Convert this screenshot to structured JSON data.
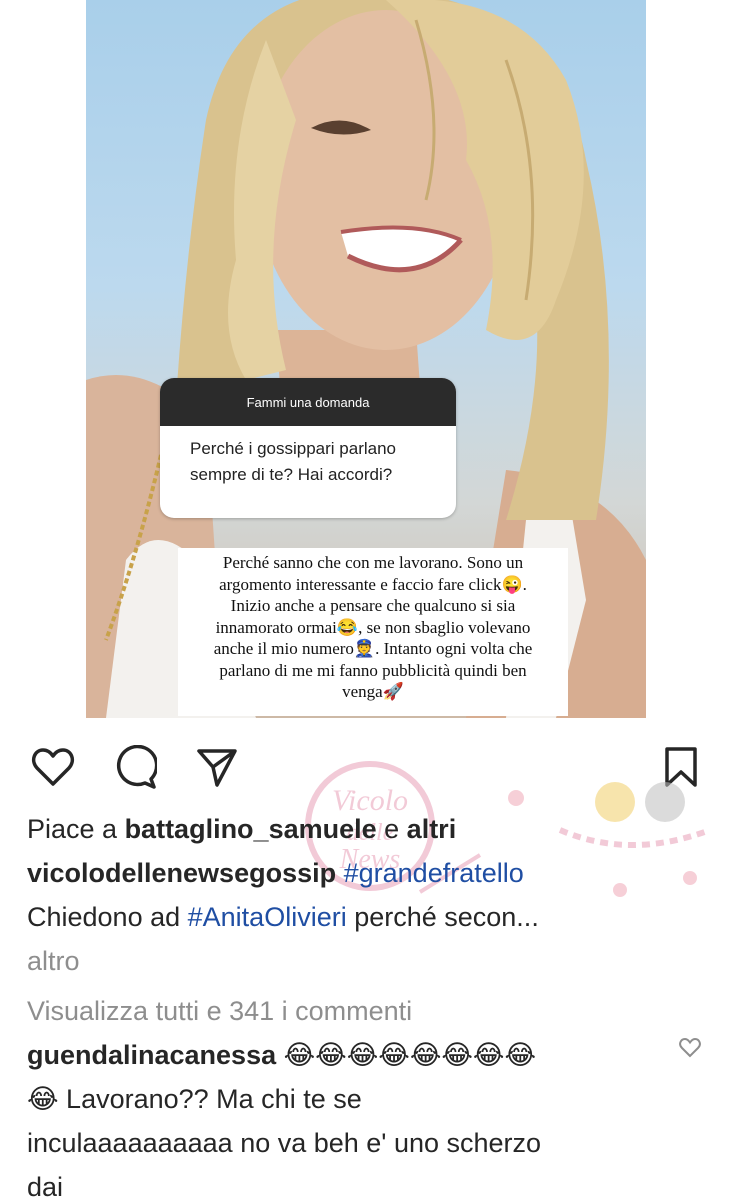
{
  "story": {
    "question_header": "Fammi una domanda",
    "question_lines": [
      "Perché i gossippari parlano",
      "sempre di te? Hai accordi?"
    ],
    "answer_lines": [
      "Perché sanno che con me lavorano. Sono un",
      "argomento interessante e faccio fare click😜.",
      "Inizio anche a pensare che qualcuno si sia",
      "innamorato ormai😂, se non sbaglio volevano",
      "anche il mio numero👮. Intanto ogni volta che",
      "parlano di me mi fanno pubblicità quindi ben",
      "venga🚀"
    ]
  },
  "actions": {
    "like_icon": "heart-icon",
    "comment_icon": "comment-icon",
    "share_icon": "send-icon",
    "save_icon": "bookmark-icon"
  },
  "likes": {
    "prefix": "Piace a ",
    "user": "battaglino_samuele",
    "and": " e ",
    "others": "altri"
  },
  "caption": {
    "username": "vicolodellenewsegossip",
    "hashtag": "#grandefratello",
    "line2_prefix": "Chiedono ad ",
    "line2_hashtag": "#AnitaOlivieri",
    "line2_suffix": " perché secon...",
    "more": "altro"
  },
  "comments": {
    "view_all": "Visualizza tutti e 341 i commenti",
    "first": {
      "username": "guendalinacanessa",
      "emojis": "😂😂😂😂😂😂😂😂",
      "line2": "😂 Lavorano?? Ma chi te se",
      "line3": "inculaaaaaaaaaa no va beh e' uno scherzo",
      "line4": "dai"
    }
  },
  "watermark": {
    "text1": "Vicolo",
    "text2": "delle",
    "text3": "News"
  },
  "colors": {
    "text": "#262626",
    "link": "#1f4ea3",
    "muted": "#8e8e8e"
  }
}
